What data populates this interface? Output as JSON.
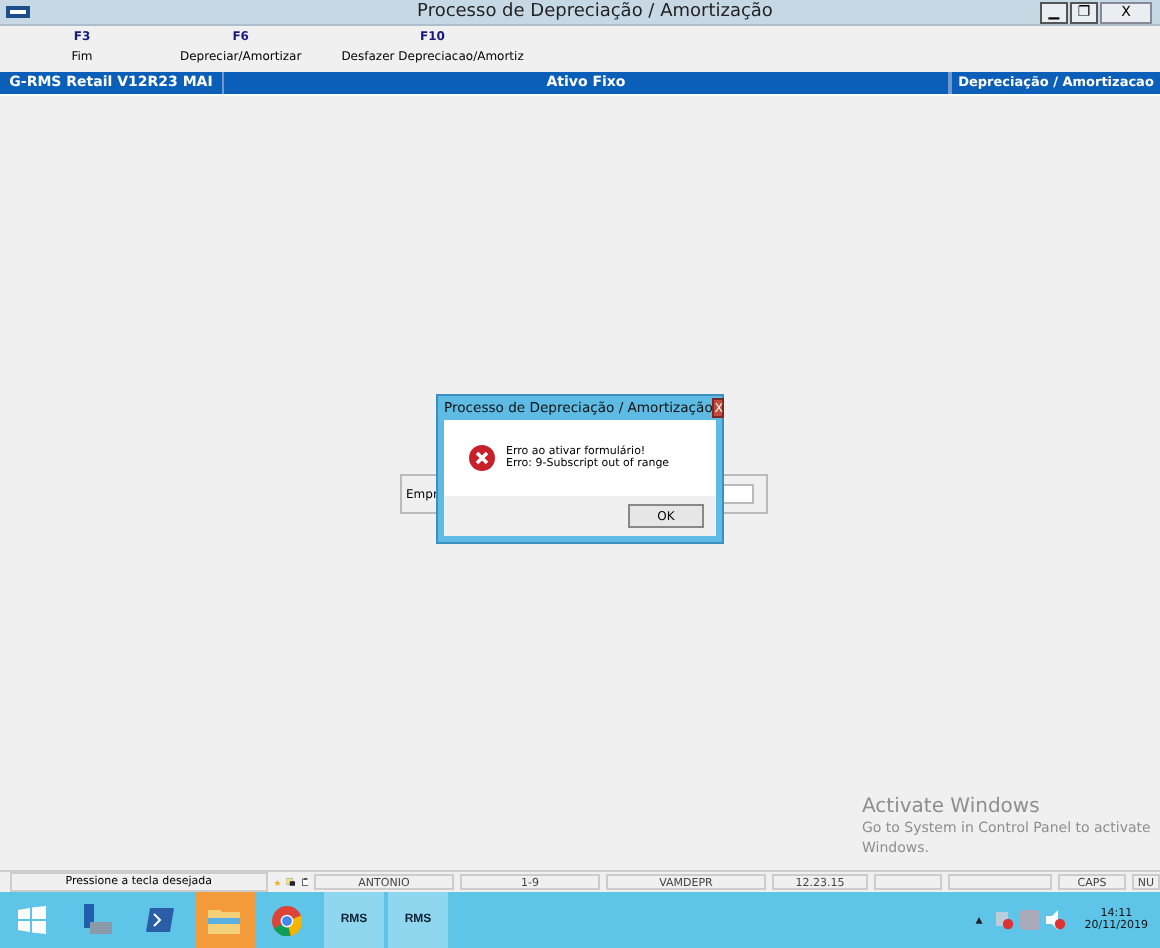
{
  "window": {
    "title": "Processo de Depreciação / Amortização",
    "controls": [
      "▁",
      "❐",
      "X"
    ]
  },
  "toolbar": [
    {
      "key": "F3",
      "label": "Fim"
    },
    {
      "key": "F6",
      "label": "Depreciar/Amortizar"
    },
    {
      "key": "F10",
      "label": "Desfazer Depreciacao/Amortiz"
    }
  ],
  "header": [
    "G-RMS Retail V12R23 MAI",
    "Ativo Fixo",
    "Depreciação / Amortizacao"
  ],
  "form": {
    "label": "Empr"
  },
  "dialog": {
    "title": "Processo de Depreciação / Amortização",
    "close": "X",
    "lines": [
      "Erro ao ativar formulário!",
      "Erro: 9-Subscript out of range"
    ],
    "button": "OK"
  },
  "activation": {
    "title": "Activate Windows",
    "text": "Go to System in Control Panel to activate Windows."
  },
  "status_bar": {
    "message": "Pressione a tecla desejada",
    "cells": [
      "ANTONIO",
      "1-9",
      "VAMDEPR",
      "12.23.15",
      "",
      "",
      "CAPS",
      "NU"
    ]
  },
  "taskbar": {
    "apps": [
      {
        "kind": "start",
        "selected": false
      },
      {
        "kind": "server",
        "selected": false
      },
      {
        "kind": "shell",
        "selected": false
      },
      {
        "kind": "folder",
        "selected": true
      },
      {
        "kind": "chrome",
        "selected": false
      },
      {
        "kind": "rms",
        "label": "RMS",
        "selected": false
      },
      {
        "kind": "rms",
        "label": "RMS",
        "selected": false
      }
    ],
    "tray_arrow": "▴",
    "time": "14:11",
    "date": "20/11/2019"
  }
}
